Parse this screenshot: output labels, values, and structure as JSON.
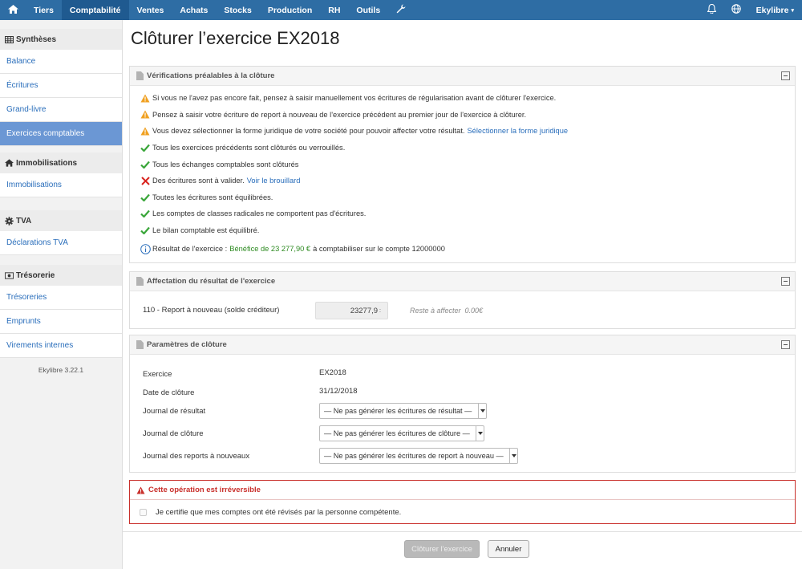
{
  "nav": {
    "items": [
      "Tiers",
      "Comptabilité",
      "Ventes",
      "Achats",
      "Stocks",
      "Production",
      "RH",
      "Outils"
    ],
    "active": "Comptabilité",
    "user": "Ekylibre",
    "icons": [
      "home-icon",
      "wrench-icon",
      "bell-icon",
      "globe-icon"
    ]
  },
  "sidebar": {
    "sections": [
      {
        "title": "Synthèses",
        "icon": "table-icon",
        "items": [
          "Balance",
          "Écritures",
          "Grand-livre",
          "Exercices comptables"
        ]
      },
      {
        "title": "Immobilisations",
        "icon": "home-icon",
        "items": [
          "Immobilisations"
        ]
      },
      {
        "title": "TVA",
        "icon": "gear-icon",
        "items": [
          "Déclarations TVA"
        ]
      },
      {
        "title": "Trésorerie",
        "icon": "money-icon",
        "items": [
          "Trésoreries",
          "Emprunts",
          "Virements internes"
        ]
      }
    ],
    "active_item": "Exercices comptables",
    "version": "Ekylibre 3.22.1"
  },
  "page": {
    "title": "Clôturer l’exercice EX2018"
  },
  "checks": {
    "title": "Vérifications préalables à la clôture",
    "rows": [
      {
        "status": "warning",
        "text": "Si vous ne l'avez pas encore fait, pensez à saisir manuellement vos écritures de régularisation avant de clôturer l'exercice.",
        "link": ""
      },
      {
        "status": "warning",
        "text": "Pensez à saisir votre écriture de report à nouveau de l'exercice précédent au premier jour de l'exercice à clôturer.",
        "link": ""
      },
      {
        "status": "warning",
        "text": "Vous devez sélectionner la forme juridique de votre société pour pouvoir affecter votre résultat.",
        "link": "Sélectionner la forme juridique"
      },
      {
        "status": "ok",
        "text": "Tous les exercices précédents sont clôturés ou verrouillés.",
        "link": ""
      },
      {
        "status": "ok",
        "text": "Tous les échanges comptables sont clôturés",
        "link": ""
      },
      {
        "status": "error",
        "text": "Des écritures sont à valider.",
        "link": "Voir le brouillard"
      },
      {
        "status": "ok",
        "text": "Toutes les écritures sont équilibrées.",
        "link": ""
      },
      {
        "status": "ok",
        "text": "Les comptes de classes radicales ne comportent pas d'écritures.",
        "link": ""
      },
      {
        "status": "ok",
        "text": "Le bilan comptable est équilibré.",
        "link": ""
      }
    ],
    "result_prefix": "Résultat de l'exercice :",
    "result_value": "Bénéfice de 23 277,90 €",
    "result_suffix": "à comptabiliser sur le compte 12000000"
  },
  "allocation": {
    "title": "Affectation du résultat de l'exercice",
    "label": "110 - Report à nouveau (solde créditeur)",
    "value": "23277,9",
    "remaining": "Reste à affecter  0.00€"
  },
  "params": {
    "title": "Paramètres de clôture",
    "exercise_label": "Exercice",
    "exercise_value": "EX2018",
    "date_label": "Date de clôture",
    "date_value": "31/12/2018",
    "journal_result_label": "Journal de résultat",
    "journal_result_value": "— Ne pas générer les écritures de résultat —",
    "journal_closure_label": "Journal de clôture",
    "journal_closure_value": "— Ne pas générer les écritures de clôture —",
    "journal_report_label": "Journal des reports à nouveaux",
    "journal_report_value": "— Ne pas générer les écritures de report à nouveau —"
  },
  "warning": {
    "title": "Cette opération est irréversible",
    "certify": "Je certifie que mes comptes ont été révisés par la personne compétente."
  },
  "actions": {
    "submit": "Clôturer l'exercice",
    "cancel": "Annuler"
  },
  "colors": {
    "nav": "#2e6da4",
    "active_side": "#6b97d4",
    "link": "#2a6ebb",
    "danger": "#c9302c",
    "success": "#2e8b22",
    "warning": "#f0a020"
  }
}
